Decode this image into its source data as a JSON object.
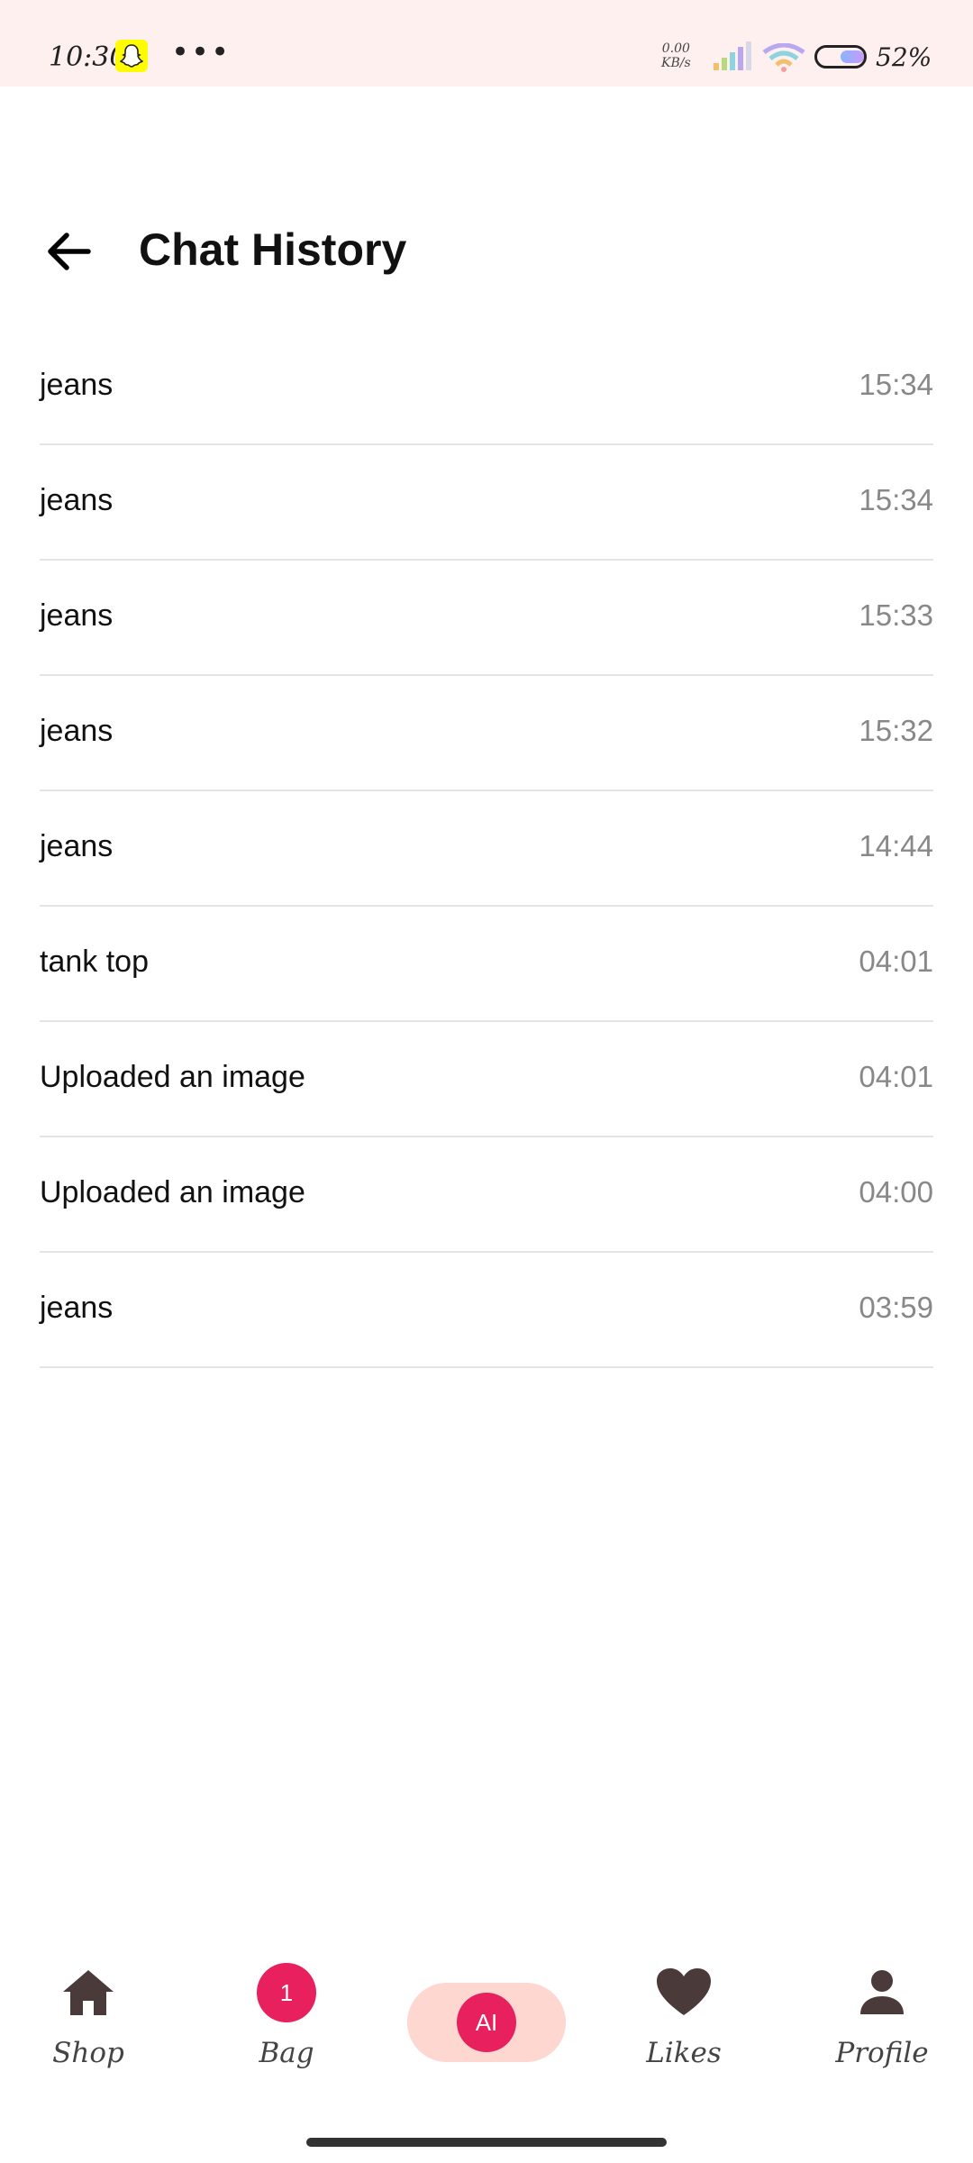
{
  "status_bar": {
    "time": "10:30",
    "more": "•••",
    "net_speed_value": "0.00",
    "net_speed_unit": "KB/s",
    "battery_percent": "52%",
    "battery_level": 0.52,
    "snapchat_icon": "snapchat-ghost-icon",
    "signal_icon": "cell-signal-icon",
    "wifi_icon": "wifi-icon"
  },
  "header": {
    "back_icon": "arrow-left-icon",
    "title": "Chat History"
  },
  "history": [
    {
      "title": "jeans",
      "time": "15:34"
    },
    {
      "title": "jeans",
      "time": "15:34"
    },
    {
      "title": "jeans",
      "time": "15:33"
    },
    {
      "title": "jeans",
      "time": "15:32"
    },
    {
      "title": "jeans",
      "time": "14:44"
    },
    {
      "title": "tank top",
      "time": "04:01"
    },
    {
      "title": "Uploaded an image",
      "time": "04:01"
    },
    {
      "title": "Uploaded an image",
      "time": "04:00"
    },
    {
      "title": "jeans",
      "time": "03:59"
    }
  ],
  "bottom_nav": {
    "shop": {
      "label": "Shop",
      "icon": "home-icon"
    },
    "bag": {
      "label": "Bag",
      "badge": "1"
    },
    "ai": {
      "label": "AI"
    },
    "likes": {
      "label": "Likes",
      "icon": "heart-icon"
    },
    "profile": {
      "label": "Profile",
      "icon": "person-icon"
    }
  },
  "colors": {
    "accent": "#e8205e",
    "ai_pill_bg": "#fdd7d0",
    "nav_icon": "#4a3a3a",
    "status_bar_bg": "#fdf0ee"
  }
}
